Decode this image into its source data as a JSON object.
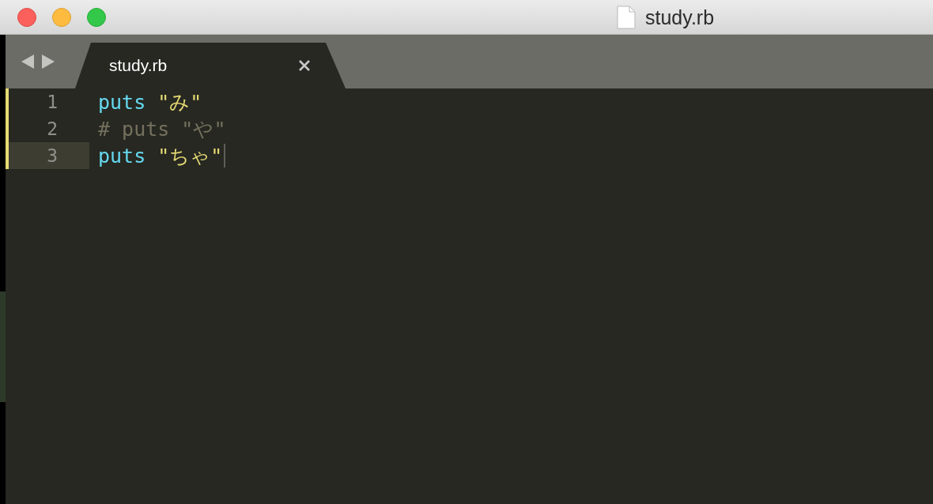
{
  "window": {
    "title": "study.rb"
  },
  "tabs": [
    {
      "label": "study.rb",
      "selected": true
    }
  ],
  "lines": [
    {
      "number": "1",
      "modified": true,
      "current": false,
      "tokens": [
        {
          "kind": "keyword",
          "text": "puts "
        },
        {
          "kind": "string",
          "text": "\"み\""
        }
      ]
    },
    {
      "number": "2",
      "modified": true,
      "current": false,
      "tokens": [
        {
          "kind": "comment",
          "text": "# puts \"や\""
        }
      ]
    },
    {
      "number": "3",
      "modified": true,
      "current": true,
      "tokens": [
        {
          "kind": "keyword",
          "text": "puts "
        },
        {
          "kind": "string",
          "text": "\"ちゃ\""
        }
      ]
    }
  ]
}
